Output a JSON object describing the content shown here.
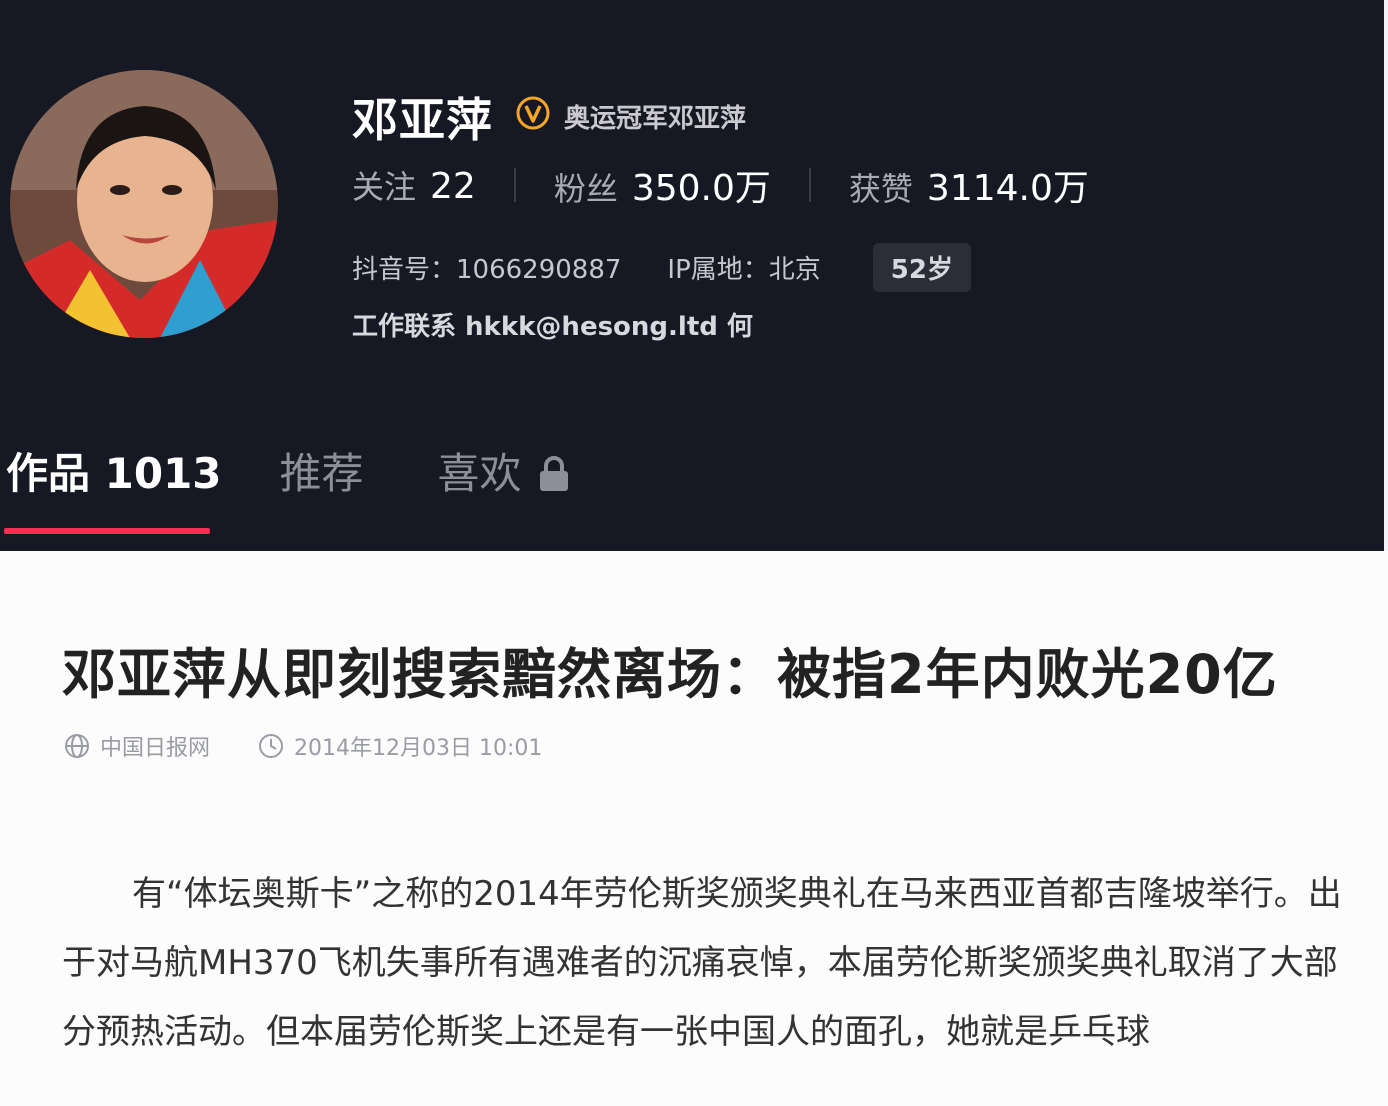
{
  "profile": {
    "name": "邓亚萍",
    "verified_label": "奥运冠军邓亚萍",
    "stats": [
      {
        "label": "关注",
        "value": "22"
      },
      {
        "label": "粉丝",
        "value": "350.0万"
      },
      {
        "label": "获赞",
        "value": "3114.0万"
      }
    ],
    "douyin_id": "抖音号：1066290887",
    "ip_location": "IP属地：北京",
    "age": "52岁",
    "contact": "工作联系 hkkk@hesong.ltd 何"
  },
  "tabs": {
    "works": "作品 1013",
    "recommend": "推荐",
    "likes": "喜欢"
  },
  "article": {
    "headline": "邓亚萍从即刻搜索黯然离场：被指2年内败光20亿",
    "source": "中国日报网",
    "datetime": "2014年12月03日 10:01",
    "body": "有“体坛奥斯卡”之称的2014年劳伦斯奖颁奖典礼在马来西亚首都吉隆坡举行。出于对马航MH370飞机失事所有遇难者的沉痛哀悼，本届劳伦斯奖颁奖典礼取消了大部分预热活动。但本届劳伦斯奖上还是有一张中国人的面孔，她就是乒乓球"
  },
  "colors": {
    "profile_bg": "#161823",
    "accent": "#fe2c55",
    "verified": "#f5a623"
  },
  "icons": [
    "verified-icon",
    "lock-icon",
    "globe-icon",
    "clock-icon"
  ]
}
